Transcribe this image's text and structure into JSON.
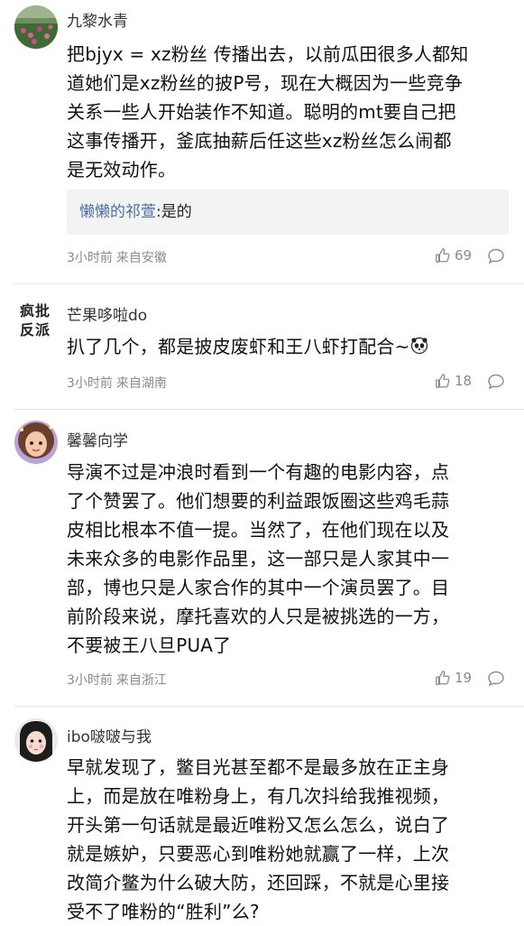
{
  "comments": [
    {
      "username": "九黎水青",
      "text": "把bjyx = xz粉丝 传播出去，以前瓜田很多人都知\n道她们是xz粉丝的披P号，现在大概因为一些竞争\n关系一些人开始装作不知道。聪明的mt要自己把\n这事传播开，釜底抽薪后任这些xz粉丝怎么闹都\n是无效动作。",
      "reply": {
        "author": "懒懒的祁萱",
        "text": ":是的"
      },
      "time": "3小时前",
      "location": "来自安徽",
      "likes": "69"
    },
    {
      "avatar_text": "疯批\n反派",
      "username": "芒果哆啦do",
      "text": "扒了几个，都是披皮废虾和王八虾打配合~",
      "time": "3小时前",
      "location": "来自湖南",
      "likes": "18"
    },
    {
      "username": "馨馨向学",
      "text": "导演不过是冲浪时看到一个有趣的电影内容，点\n了个赞罢了。他们想要的利益跟饭圈这些鸡毛蒜\n皮相比根本不值一提。当然了，在他们现在以及\n未来众多的电影作品里，这一部只是人家其中一\n部，博也只是人家合作的其中一个演员罢了。目\n前阶段来说，摩托喜欢的人只是被挑选的一方，\n不要被王八旦PUA了",
      "time": "3小时前",
      "location": "来自浙江",
      "likes": "19"
    },
    {
      "username": "ibo啵啵与我",
      "text": "早就发现了，鳖目光甚至都不是最多放在正主身\n上，而是放在唯粉身上，有几次抖给我推视频，\n开头第一句话就是最近唯粉又怎么怎么，说白了\n就是嫉妒，只要恶心到唯粉她就赢了一样，上次\n改简介鳖为什么破大防，还回踩，不就是心里接\n受不了唯粉的“胜利”么?"
    }
  ],
  "colors": {
    "reply_author": "#4a6fa5",
    "meta": "#8a8a8a",
    "reply_bg": "#f3f3f3"
  },
  "icons": {
    "like": "thumbs-up-icon",
    "reply": "comment-bubble-icon"
  }
}
